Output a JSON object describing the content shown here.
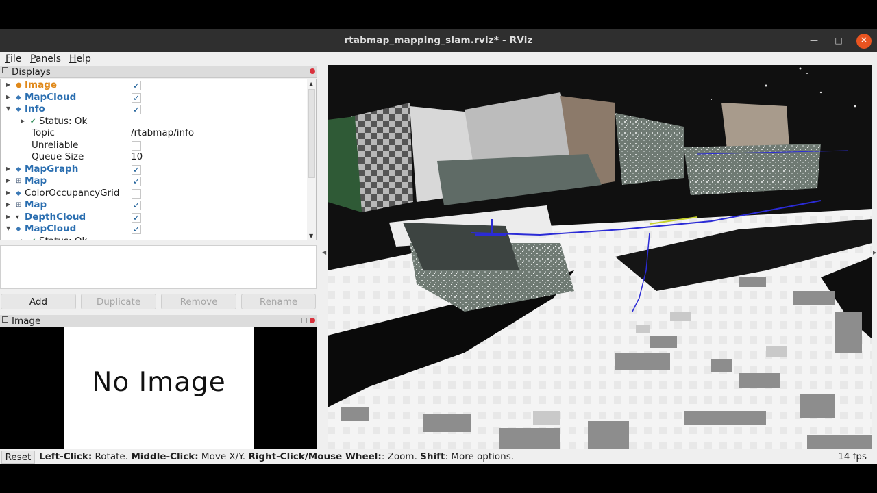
{
  "window": {
    "title": "rtabmap_mapping_slam.rviz* - RViz",
    "minimize_glyph": "—",
    "maximize_glyph": "□",
    "close_glyph": "✕"
  },
  "menu": [
    {
      "underline": "F",
      "rest": "ile"
    },
    {
      "underline": "P",
      "rest": "anels"
    },
    {
      "underline": "H",
      "rest": "elp"
    }
  ],
  "displays_panel": {
    "title": "Displays",
    "rows": [
      {
        "label": "Image",
        "checked": true,
        "style": "orange",
        "icon": "dot"
      },
      {
        "label": "MapCloud",
        "checked": true,
        "style": "blue",
        "icon": "diamond"
      },
      {
        "label": "Info",
        "checked": true,
        "style": "blue",
        "icon": "diamond",
        "expanded": true
      },
      {
        "label": "Status: Ok",
        "style": "plain",
        "child": true,
        "icon": "check"
      },
      {
        "label": "Topic",
        "value": "/rtabmap/info",
        "style": "plain",
        "property": true
      },
      {
        "label": "Unreliable",
        "checked": false,
        "style": "plain",
        "property": true
      },
      {
        "label": "Queue Size",
        "value": "10",
        "style": "plain",
        "property": true
      },
      {
        "label": "MapGraph",
        "checked": true,
        "style": "blue",
        "icon": "diamond"
      },
      {
        "label": "Map",
        "checked": true,
        "style": "blue",
        "icon": "grid"
      },
      {
        "label": "ColorOccupancyGrid",
        "checked": false,
        "style": "plain",
        "icon": "diamond"
      },
      {
        "label": "Map",
        "checked": true,
        "style": "blue",
        "icon": "grid"
      },
      {
        "label": "DepthCloud",
        "checked": true,
        "style": "blue",
        "icon": "arrow"
      },
      {
        "label": "MapCloud",
        "checked": true,
        "style": "blue",
        "icon": "diamond",
        "expanded": true
      },
      {
        "label": "Status: Ok",
        "style": "plain",
        "child": true,
        "icon": "check"
      }
    ],
    "buttons": {
      "add": "Add",
      "duplicate": "Duplicate",
      "remove": "Remove",
      "rename": "Rename"
    }
  },
  "image_panel": {
    "title": "Image",
    "placeholder_text": "No Image"
  },
  "statusbar": {
    "reset": "Reset",
    "hint_1_key": "Left-Click:",
    "hint_1_val": " Rotate. ",
    "hint_2_key": "Middle-Click:",
    "hint_2_val": " Move X/Y. ",
    "hint_3_key": "Right-Click/Mouse Wheel:",
    "hint_3_val": ": Zoom. ",
    "hint_4_key": "Shift",
    "hint_4_val": ": More options.",
    "fps": "14 fps"
  },
  "colors": {
    "orange": "#e0891a",
    "blue": "#2a6eb0",
    "close_button": "#e95420",
    "panel_close": "#d9313c"
  }
}
